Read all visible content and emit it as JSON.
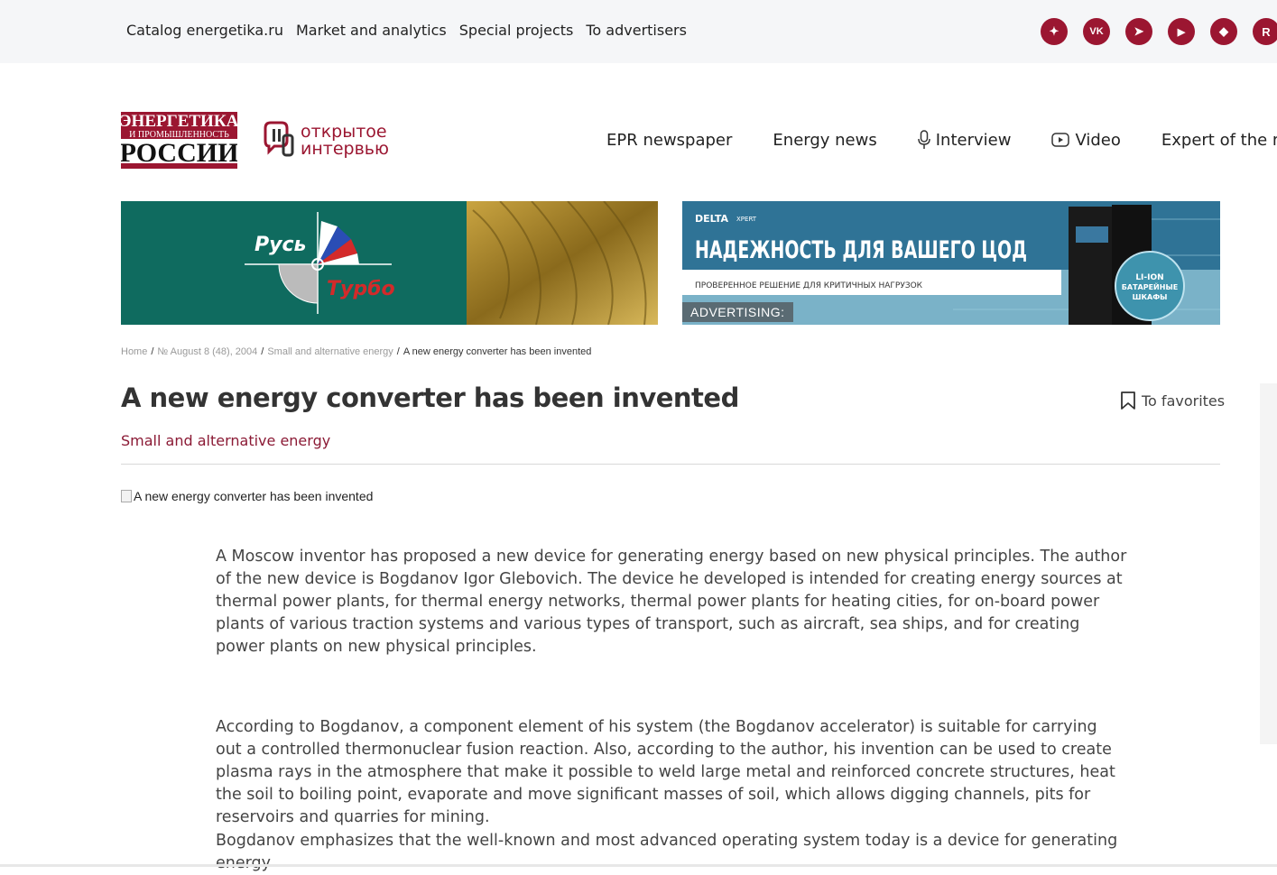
{
  "topnav": [
    "Catalog energetika.ru",
    "Market and analytics",
    "Special projects",
    "To advertisers"
  ],
  "socials": [
    {
      "icon": "dzen-icon",
      "glyph": "✦"
    },
    {
      "icon": "vk-icon",
      "glyph": "VK"
    },
    {
      "icon": "telegram-icon",
      "glyph": "➤"
    },
    {
      "icon": "youtube-icon",
      "glyph": "▶"
    },
    {
      "icon": "pin-icon",
      "glyph": "◆"
    },
    {
      "icon": "rutube-icon",
      "glyph": "R"
    }
  ],
  "logo1": {
    "line1": "ЭНЕРГЕТИКА",
    "line2": "И ПРОМЫШЛЕННОСТЬ",
    "line3": "РОССИИ"
  },
  "logo2": {
    "line1": "открытое",
    "line2": "интервью"
  },
  "mainnav": {
    "epr": "EPR newspaper",
    "news": "Energy news",
    "interview": "Interview",
    "video": "Video",
    "expert": "Expert of the mont"
  },
  "ad1": {
    "word1": "Русь",
    "word2": "Турбо"
  },
  "ad2": {
    "brand": "DELTA",
    "brand2": "XPERT",
    "headline": "НАДЕЖНОСТЬ ДЛЯ ВАШЕГО ЦОД",
    "sub": "ПРОВЕРЕННОЕ РЕШЕНИЕ ДЛЯ КРИТИЧНЫХ НАГРУЗОК",
    "badge1": "LI-ION",
    "badge2": "БАТАРЕЙНЫЕ",
    "badge3": "ШКАФЫ",
    "label": "ADVERTISING:"
  },
  "breadcrumbs": {
    "home": "Home",
    "issue": "№ August 8 (48), 2004",
    "section": "Small and alternative energy",
    "current": "A new energy converter has been invented"
  },
  "title": "A new energy converter has been invented",
  "favorites": "To favorites",
  "category": "Small and alternative energy",
  "image_alt": "A new energy converter has been invented",
  "paragraphs": [
    "A Moscow inventor has proposed a new device for generating energy based on new physical principles. The author of the new device is Bogdanov Igor Glebovich. The device he developed is intended for creating energy sources at thermal power plants, for thermal energy networks, thermal power plants for heating cities, for on-board power plants of various traction systems and various types of transport, such as aircraft, sea ships, and for creating power plants on new physical principles.",
    "According to Bogdanov, a component element of his system (the Bogdanov accelerator) is suitable for carrying out a controlled thermonuclear fusion reaction. Also, according to the author, his invention can be used to create plasma rays in the atmosphere that make it possible to weld large metal and reinforced concrete structures, heat the soil to boiling point, evaporate and move significant masses of soil, which allows digging channels, pits for reservoirs and quarries for mining.",
    "Bogdanov emphasizes that the well-known and most advanced operating system today is a device for generating energy"
  ],
  "colors": {
    "brand": "#9b1631",
    "category": "#8b1a35",
    "topbar": "#f5f6f8"
  }
}
